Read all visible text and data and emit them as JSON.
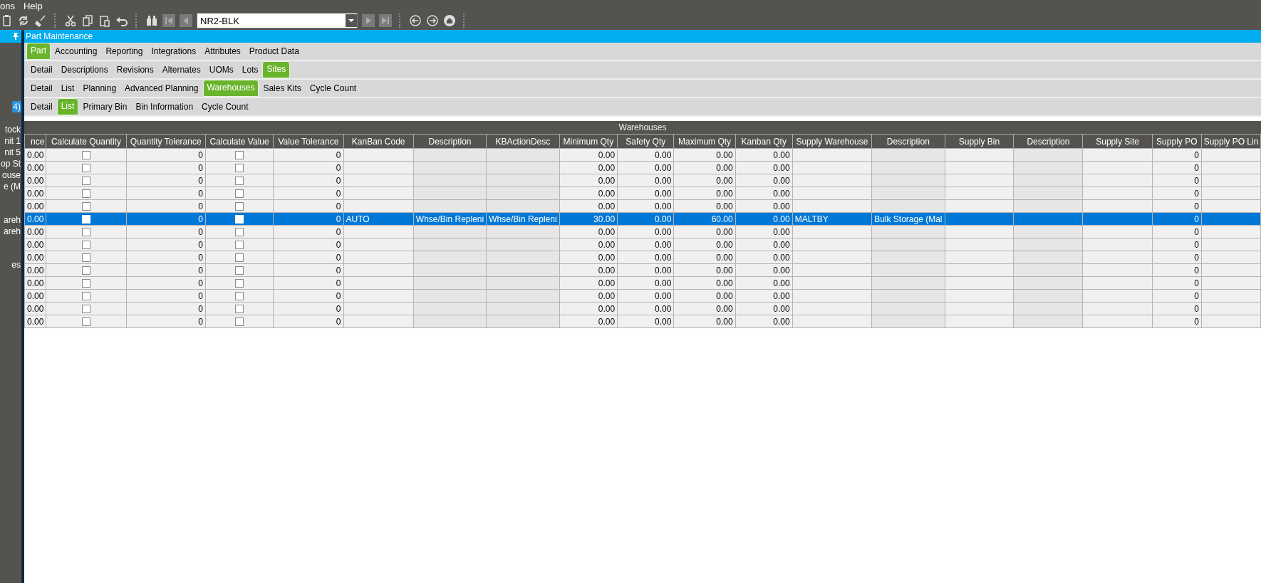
{
  "menu_bar": [
    "ons",
    "Help"
  ],
  "toolbar": {
    "part_number": "NR2-BLK"
  },
  "window": {
    "title": "Part Maintenance"
  },
  "sidebar": {
    "items": [
      {
        "label": "4)",
        "selected": true
      },
      {
        "label": "tock",
        "selected": false
      },
      {
        "label": "nit 1",
        "selected": false
      },
      {
        "label": "nit 5",
        "selected": false
      },
      {
        "label": "op St",
        "selected": false
      },
      {
        "label": "ouse",
        "selected": false
      },
      {
        "label": "e (M",
        "selected": false
      },
      {
        "label": "areh",
        "selected": false
      },
      {
        "label": "areh",
        "selected": false
      },
      {
        "label": "es",
        "selected": false
      }
    ]
  },
  "tab_rows": [
    [
      {
        "label": "Part",
        "selected": true
      },
      {
        "label": "Accounting",
        "selected": false
      },
      {
        "label": "Reporting",
        "selected": false
      },
      {
        "label": "Integrations",
        "selected": false
      },
      {
        "label": "Attributes",
        "selected": false
      },
      {
        "label": "Product Data",
        "selected": false
      }
    ],
    [
      {
        "label": "Detail",
        "selected": false
      },
      {
        "label": "Descriptions",
        "selected": false
      },
      {
        "label": "Revisions",
        "selected": false
      },
      {
        "label": "Alternates",
        "selected": false
      },
      {
        "label": "UOMs",
        "selected": false
      },
      {
        "label": "Lots",
        "selected": false
      },
      {
        "label": "Sites",
        "selected": true
      }
    ],
    [
      {
        "label": "Detail",
        "selected": false
      },
      {
        "label": "List",
        "selected": false
      },
      {
        "label": "Planning",
        "selected": false
      },
      {
        "label": "Advanced Planning",
        "selected": false
      },
      {
        "label": "Warehouses",
        "selected": true
      },
      {
        "label": "Sales Kits",
        "selected": false
      },
      {
        "label": "Cycle Count",
        "selected": false
      }
    ],
    [
      {
        "label": "Detail",
        "selected": false
      },
      {
        "label": "List",
        "selected": true
      },
      {
        "label": "Primary Bin",
        "selected": false
      },
      {
        "label": "Bin Information",
        "selected": false
      },
      {
        "label": "Cycle Count",
        "selected": false
      }
    ]
  ],
  "table": {
    "title": "Warehouses",
    "columns": [
      {
        "label": "nce",
        "kind": "number"
      },
      {
        "label": "Calculate Quantity",
        "kind": "check"
      },
      {
        "label": "Quantity Tolerance",
        "kind": "number"
      },
      {
        "label": "Calculate Value",
        "kind": "check"
      },
      {
        "label": "Value Tolerance",
        "kind": "number"
      },
      {
        "label": "KanBan Code",
        "kind": "text"
      },
      {
        "label": "Description",
        "kind": "readonly"
      },
      {
        "label": "KBActionDesc",
        "kind": "readonly"
      },
      {
        "label": "Minimum Qty",
        "kind": "number"
      },
      {
        "label": "Safety Qty",
        "kind": "number"
      },
      {
        "label": "Maximum Qty",
        "kind": "number"
      },
      {
        "label": "Kanban Qty",
        "kind": "number"
      },
      {
        "label": "Supply Warehouse",
        "kind": "text"
      },
      {
        "label": "Description",
        "kind": "readonly"
      },
      {
        "label": "Supply Bin",
        "kind": "text"
      },
      {
        "label": "Description",
        "kind": "readonly"
      },
      {
        "label": "Supply Site",
        "kind": "text"
      },
      {
        "label": "Supply PO",
        "kind": "number"
      },
      {
        "label": "Supply PO Lin",
        "kind": "text"
      }
    ],
    "rows": [
      {
        "selected": false,
        "cells": [
          "0.00",
          false,
          "0",
          false,
          "0",
          null,
          null,
          null,
          "0.00",
          "0.00",
          "0.00",
          "0.00",
          null,
          null,
          null,
          null,
          null,
          "0",
          null
        ]
      },
      {
        "selected": false,
        "cells": [
          "0.00",
          false,
          "0",
          false,
          "0",
          null,
          null,
          null,
          "0.00",
          "0.00",
          "0.00",
          "0.00",
          null,
          null,
          null,
          null,
          null,
          "0",
          null
        ]
      },
      {
        "selected": false,
        "cells": [
          "0.00",
          false,
          "0",
          false,
          "0",
          null,
          null,
          null,
          "0.00",
          "0.00",
          "0.00",
          "0.00",
          null,
          null,
          null,
          null,
          null,
          "0",
          null
        ]
      },
      {
        "selected": false,
        "cells": [
          "0.00",
          false,
          "0",
          false,
          "0",
          null,
          null,
          null,
          "0.00",
          "0.00",
          "0.00",
          "0.00",
          null,
          null,
          null,
          null,
          null,
          "0",
          null
        ]
      },
      {
        "selected": false,
        "cells": [
          "0.00",
          false,
          "0",
          false,
          "0",
          null,
          null,
          null,
          "0.00",
          "0.00",
          "0.00",
          "0.00",
          null,
          null,
          null,
          null,
          null,
          "0",
          null
        ]
      },
      {
        "selected": true,
        "cells": [
          "0.00",
          false,
          "0",
          false,
          "0",
          "AUTO",
          "Whse/Bin Repleni",
          "Whse/Bin Repleni",
          "30.00",
          "0.00",
          "60.00",
          "0.00",
          "MALTBY",
          "Bulk Storage (Mal",
          null,
          null,
          null,
          "0",
          null
        ]
      },
      {
        "selected": false,
        "cells": [
          "0.00",
          false,
          "0",
          false,
          "0",
          null,
          null,
          null,
          "0.00",
          "0.00",
          "0.00",
          "0.00",
          null,
          null,
          null,
          null,
          null,
          "0",
          null
        ]
      },
      {
        "selected": false,
        "cells": [
          "0.00",
          false,
          "0",
          false,
          "0",
          null,
          null,
          null,
          "0.00",
          "0.00",
          "0.00",
          "0.00",
          null,
          null,
          null,
          null,
          null,
          "0",
          null
        ]
      },
      {
        "selected": false,
        "cells": [
          "0.00",
          false,
          "0",
          false,
          "0",
          null,
          null,
          null,
          "0.00",
          "0.00",
          "0.00",
          "0.00",
          null,
          null,
          null,
          null,
          null,
          "0",
          null
        ]
      },
      {
        "selected": false,
        "cells": [
          "0.00",
          false,
          "0",
          false,
          "0",
          null,
          null,
          null,
          "0.00",
          "0.00",
          "0.00",
          "0.00",
          null,
          null,
          null,
          null,
          null,
          "0",
          null
        ]
      },
      {
        "selected": false,
        "cells": [
          "0.00",
          false,
          "0",
          false,
          "0",
          null,
          null,
          null,
          "0.00",
          "0.00",
          "0.00",
          "0.00",
          null,
          null,
          null,
          null,
          null,
          "0",
          null
        ]
      },
      {
        "selected": false,
        "cells": [
          "0.00",
          false,
          "0",
          false,
          "0",
          null,
          null,
          null,
          "0.00",
          "0.00",
          "0.00",
          "0.00",
          null,
          null,
          null,
          null,
          null,
          "0",
          null
        ]
      },
      {
        "selected": false,
        "cells": [
          "0.00",
          false,
          "0",
          false,
          "0",
          null,
          null,
          null,
          "0.00",
          "0.00",
          "0.00",
          "0.00",
          null,
          null,
          null,
          null,
          null,
          "0",
          null
        ]
      },
      {
        "selected": false,
        "cells": [
          "0.00",
          false,
          "0",
          false,
          "0",
          null,
          null,
          null,
          "0.00",
          "0.00",
          "0.00",
          "0.00",
          null,
          null,
          null,
          null,
          null,
          "0",
          null
        ]
      }
    ]
  }
}
